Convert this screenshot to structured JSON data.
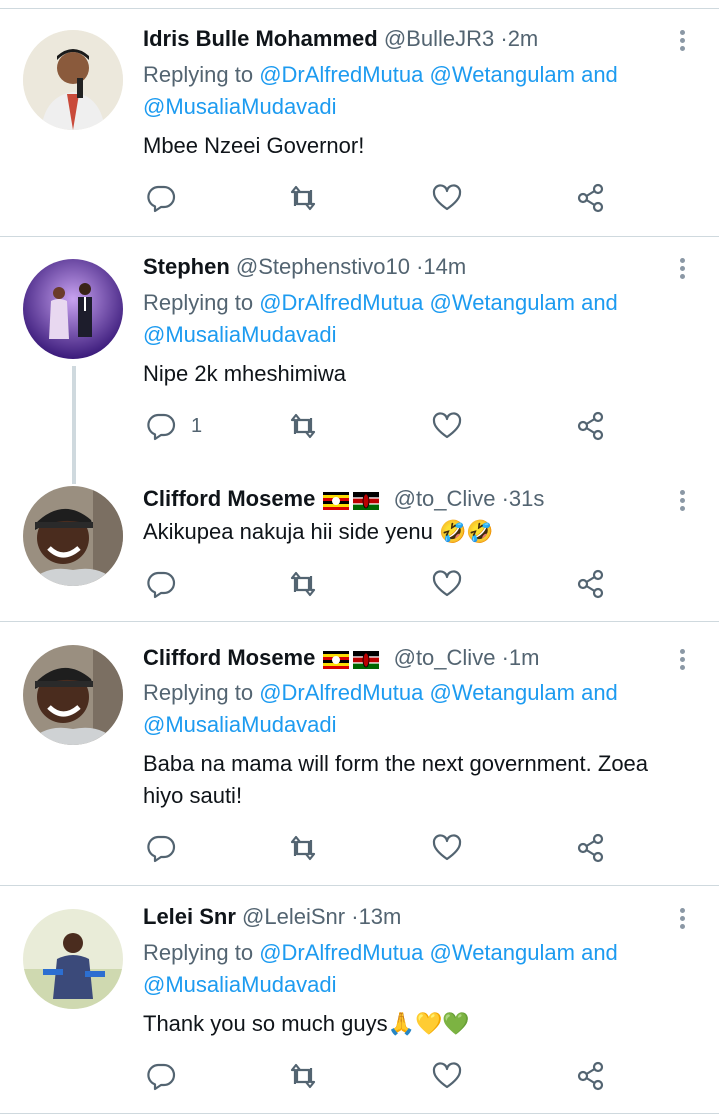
{
  "replying_label": "Replying to",
  "and_label": "and",
  "tweets": [
    {
      "name": "Idris Bulle Mohammed",
      "handle": "@BulleJR3",
      "time": "2m",
      "mentions": [
        "@DrAlfredMutua",
        "@Wetangulam",
        "@MusaliaMudavadi"
      ],
      "text": "Mbee Nzeei Governor!",
      "reply_count": ""
    },
    {
      "name": "Stephen",
      "handle": "@Stephenstivo10",
      "time": "14m",
      "mentions": [
        "@DrAlfredMutua",
        "@Wetangulam",
        "@MusaliaMudavadi"
      ],
      "text": "Nipe 2k mheshimiwa",
      "reply_count": "1"
    },
    {
      "name": "Clifford Moseme",
      "handle": "@to_Clive",
      "time": "31s",
      "flags": [
        "uganda-flag",
        "kenya-flag"
      ],
      "text": "Akikupea nakuja hii side yenu 🤣🤣",
      "reply_count": ""
    },
    {
      "name": "Clifford Moseme",
      "handle": "@to_Clive",
      "time": "1m",
      "flags": [
        "uganda-flag",
        "kenya-flag"
      ],
      "mentions": [
        "@DrAlfredMutua",
        "@Wetangulam",
        "@MusaliaMudavadi"
      ],
      "text_line1": "Baba na mama will form the next government. Zoea",
      "text_line2": "hiyo sauti!",
      "reply_count": ""
    },
    {
      "name": "Lelei Snr",
      "handle": "@LeleiSnr",
      "time": "13m",
      "mentions": [
        "@DrAlfredMutua",
        "@Wetangulam",
        "@MusaliaMudavadi"
      ],
      "text": "Thank you so much guys🙏💛💚",
      "reply_count": ""
    }
  ],
  "icons": [
    "reply-icon",
    "retweet-icon",
    "like-icon",
    "share-icon",
    "more-icon"
  ],
  "colors": {
    "link": "#1d9bf0",
    "muted": "#536471",
    "text": "#0f1419",
    "divider": "#cfd9de"
  }
}
